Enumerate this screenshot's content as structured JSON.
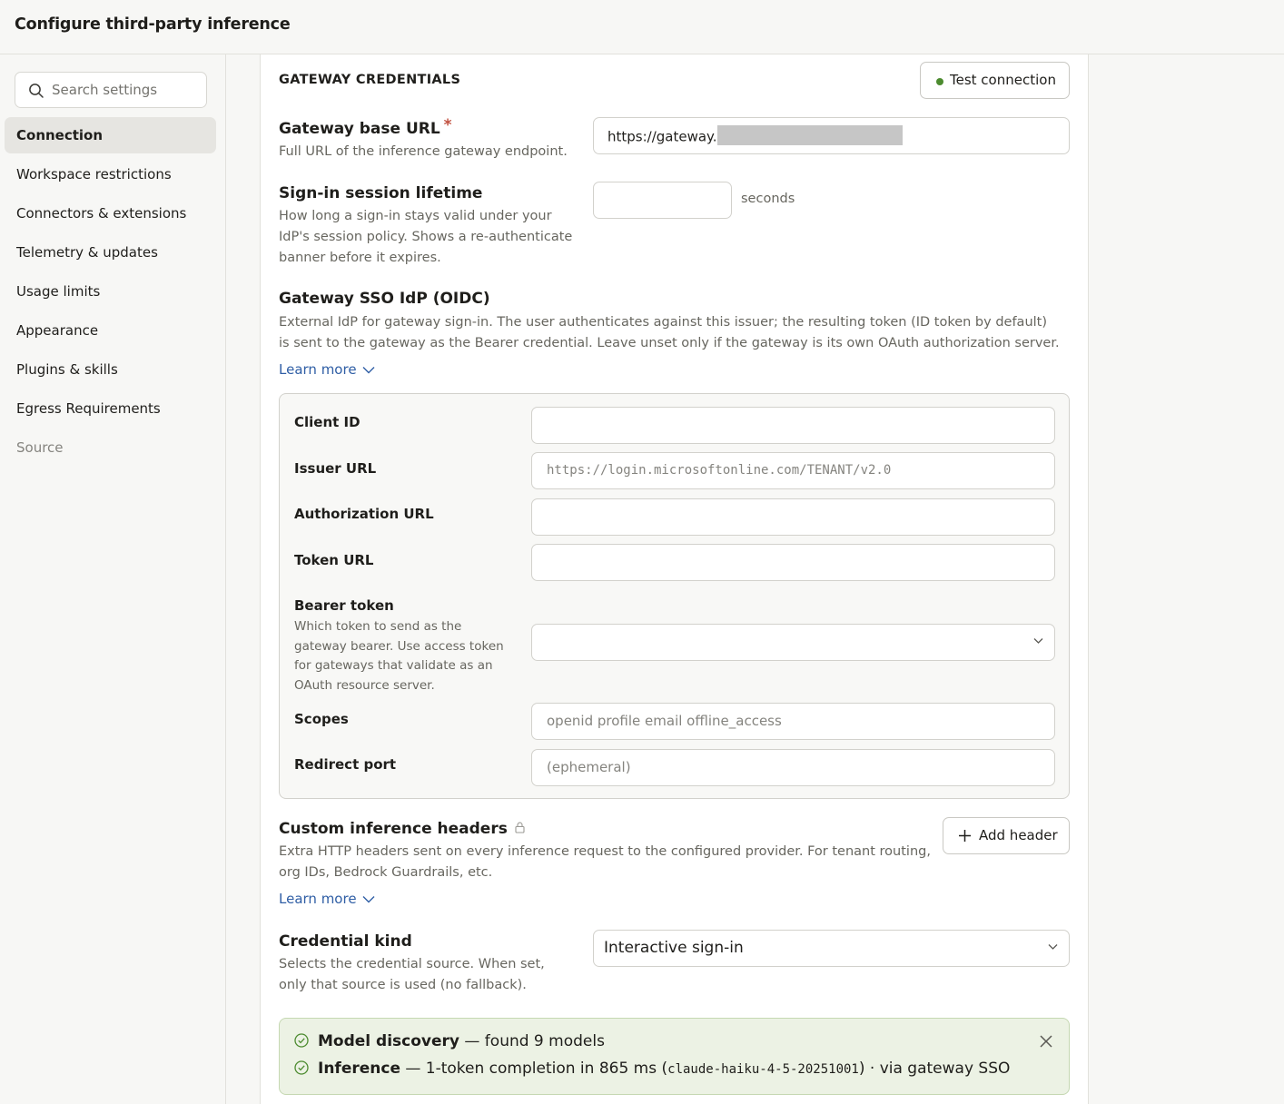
{
  "window": {
    "title": "Configure third-party inference"
  },
  "sidebar": {
    "search_placeholder": "Search settings",
    "items": [
      {
        "label": "Connection",
        "active": true
      },
      {
        "label": "Workspace restrictions"
      },
      {
        "label": "Connectors & extensions"
      },
      {
        "label": "Telemetry & updates"
      },
      {
        "label": "Usage limits"
      },
      {
        "label": "Appearance"
      },
      {
        "label": "Plugins & skills"
      },
      {
        "label": "Egress Requirements"
      },
      {
        "label": "Source",
        "muted": true
      }
    ]
  },
  "main": {
    "section_title": "GATEWAY CREDENTIALS",
    "test_connection_label": "Test connection",
    "status_dot_color": "#4c8b2f",
    "gateway_url": {
      "title": "Gateway base URL",
      "required_mark": "*",
      "description": "Full URL of the inference gateway endpoint.",
      "value_prefix": "https://gateway."
    },
    "session_lifetime": {
      "title": "Sign-in session lifetime",
      "description": "How long a sign-in stays valid under your IdP's session policy. Shows a re-authenticate banner before it expires.",
      "value": "",
      "unit": "seconds"
    },
    "sso_idp": {
      "title": "Gateway SSO IdP (OIDC)",
      "description": "External IdP for gateway sign-in. The user authenticates against this issuer; the resulting token (ID token by default) is sent to the gateway as the Bearer credential. Leave unset only if the gateway is its own OAuth authorization server.",
      "learn_more": "Learn more",
      "fields": {
        "client_id": {
          "label": "Client ID",
          "value": ""
        },
        "issuer_url": {
          "label": "Issuer URL",
          "placeholder": "https://login.microsoftonline.com/TENANT/v2.0"
        },
        "authorization_url": {
          "label": "Authorization URL",
          "value": ""
        },
        "token_url": {
          "label": "Token URL",
          "value": ""
        },
        "bearer_token": {
          "label": "Bearer token",
          "description": "Which token to send as the gateway bearer. Use access token for gateways that validate as an OAuth resource server.",
          "value": ""
        },
        "scopes": {
          "label": "Scopes",
          "placeholder": "openid profile email offline_access"
        },
        "redirect_port": {
          "label": "Redirect port",
          "placeholder": "(ephemeral)"
        }
      }
    },
    "custom_headers": {
      "title": "Custom inference headers",
      "description": "Extra HTTP headers sent on every inference request to the configured provider. For tenant routing, org IDs, Bedrock Guardrails, etc.",
      "learn_more": "Learn more",
      "add_label": "Add header"
    },
    "credential_kind": {
      "title": "Credential kind",
      "description": "Selects the credential source. When set, only that source is used (no fallback).",
      "value": "Interactive sign-in"
    },
    "status": {
      "model_discovery_label": "Model discovery",
      "model_discovery_text": " — found 9 models",
      "inference_label": "Inference",
      "inference_prefix": " — 1-token completion in 865 ms (",
      "inference_model": "claude-haiku-4-5-20251001",
      "inference_suffix": ") · via gateway SSO"
    }
  }
}
